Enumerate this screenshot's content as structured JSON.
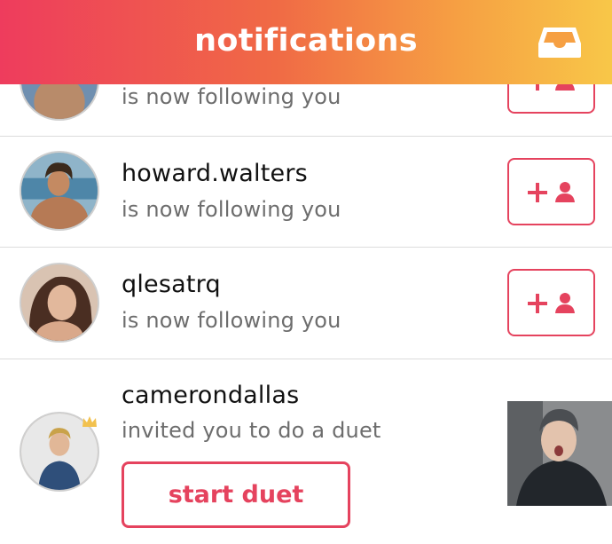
{
  "header": {
    "title": "notifications",
    "gradient": [
      "#ee3c5d",
      "#f06a45",
      "#f6a043",
      "#f8c748"
    ],
    "inbox_icon": "inbox-tray-icon"
  },
  "accent_color": "#e5435e",
  "notifications": [
    {
      "username": "",
      "text": "is now following you",
      "action_icon": "follow-back-icon"
    },
    {
      "username": "howard.walters",
      "text": "is now following you",
      "action_icon": "follow-back-icon"
    },
    {
      "username": "qlesatrq",
      "text": "is now following you",
      "action_icon": "follow-back-icon"
    },
    {
      "username": "camerondallas",
      "text": "invited you to do a duet",
      "badge_icon": "crown-icon",
      "action_label": "start duet"
    }
  ]
}
